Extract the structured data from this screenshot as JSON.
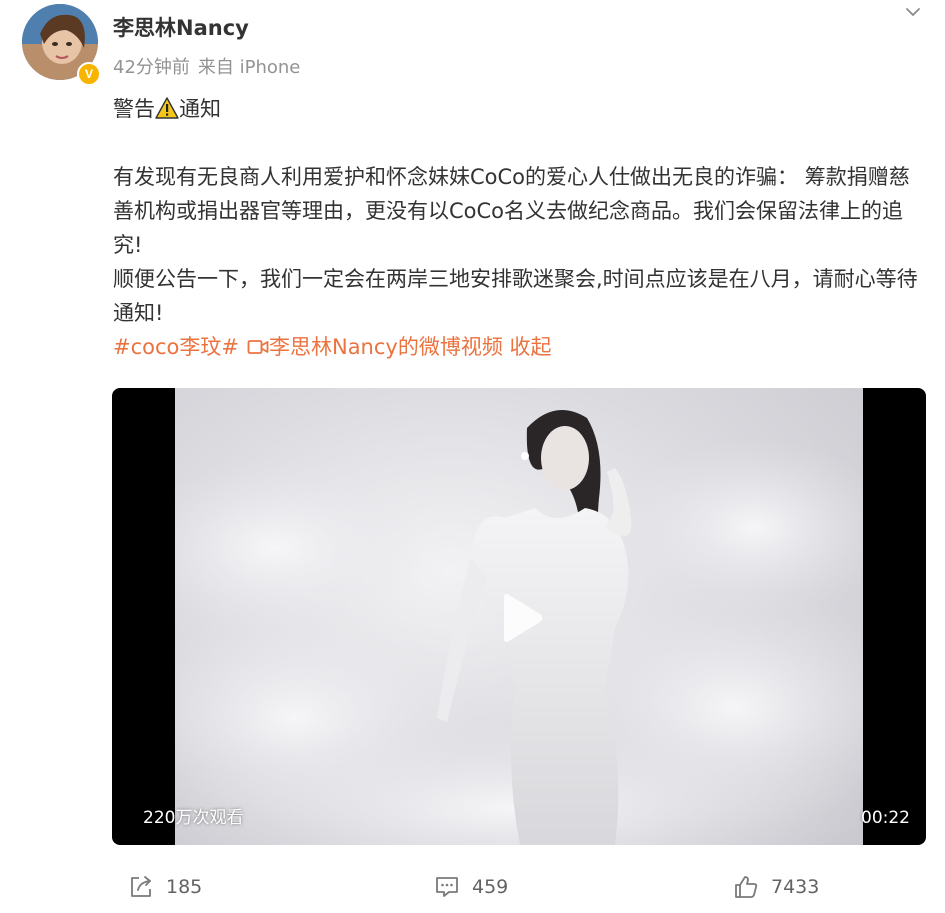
{
  "author": {
    "name": "李思林Nancy",
    "verified_icon": "verified-badge-icon",
    "time_ago": "42分钟前",
    "source": "来自 iPhone"
  },
  "post": {
    "warning_prefix": "警告",
    "warning_suffix": "通知",
    "paragraph_1": "有发现有无良商人利用爱护和怀念妹妹CoCo的爱心人仕做出无良的诈骗： 筹款捐赠慈善机构或捐出器官等理由，更没有以CoCo名义去做纪念商品。我们会保留法律上的追究!",
    "paragraph_2": "顺便公告一下，我们一定会在两岸三地安排歌迷聚会,时间点应该是在八月，请耐心等待通知!",
    "hashtag": "#coco李玟#",
    "video_link": "李思林Nancy的微博视频",
    "collapse": "收起"
  },
  "video": {
    "views": "220万次观看",
    "duration": "00:22"
  },
  "actions": {
    "repost_count": "185",
    "comment_count": "459",
    "like_count": "7433"
  },
  "colors": {
    "link": "#eb7340",
    "verified": "#f7b500",
    "meta": "#939393"
  }
}
